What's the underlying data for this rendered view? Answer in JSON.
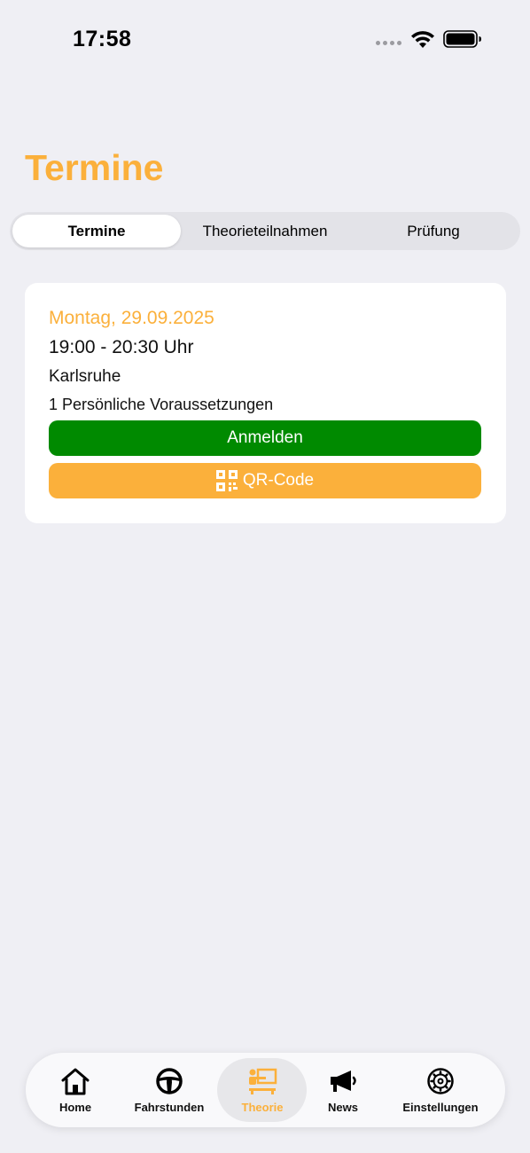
{
  "status_bar": {
    "time": "17:58"
  },
  "header": {
    "title": "Termine"
  },
  "segments": [
    {
      "label": "Termine",
      "active": true
    },
    {
      "label": "Theorieteilnahmen",
      "active": false
    },
    {
      "label": "Prüfung",
      "active": false
    }
  ],
  "appointment": {
    "date": "Montag, 29.09.2025",
    "time": "19:00 - 20:30 Uhr",
    "location": "Karlsruhe",
    "requirements": "1 Persönliche Voraussetzungen",
    "register_label": "Anmelden",
    "qr_label": "QR-Code"
  },
  "tab_bar": {
    "items": [
      {
        "label": "Home",
        "icon": "house-icon"
      },
      {
        "label": "Fahrstunden",
        "icon": "steering-wheel-icon"
      },
      {
        "label": "Theorie",
        "icon": "classroom-icon",
        "active": true
      },
      {
        "label": "News",
        "icon": "megaphone-icon"
      },
      {
        "label": "Einstellungen",
        "icon": "gear-icon"
      }
    ]
  },
  "colors": {
    "accent": "#fbb03b",
    "register_button": "#008a00",
    "background": "#efeff4"
  }
}
